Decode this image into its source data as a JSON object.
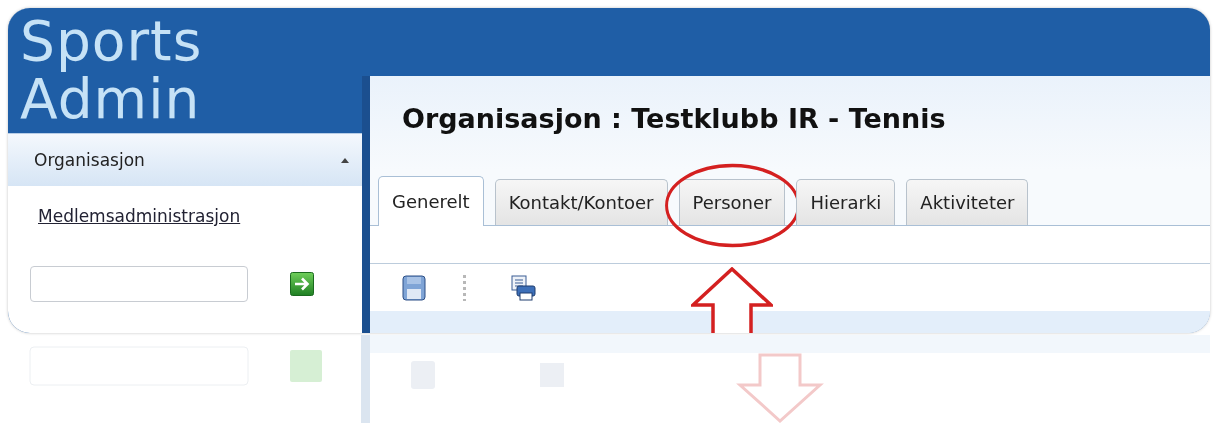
{
  "logo": {
    "line_1": "Sports",
    "line_2": "Admin"
  },
  "sidebar": {
    "section": {
      "title": "Organisasjon",
      "expanded": true
    },
    "link": "Medlemsadministrasjon"
  },
  "page_title": "Organisasjon : Testklubb IR - Tennis",
  "tabs": [
    {
      "label": "Generelt",
      "selected": true,
      "highlighted": false
    },
    {
      "label": "Kontakt/Kontoer",
      "selected": false,
      "highlighted": false
    },
    {
      "label": "Personer",
      "selected": false,
      "highlighted": true
    },
    {
      "label": "Hierarki",
      "selected": false,
      "highlighted": false
    },
    {
      "label": "Aktiviteter",
      "selected": false,
      "highlighted": false
    }
  ]
}
